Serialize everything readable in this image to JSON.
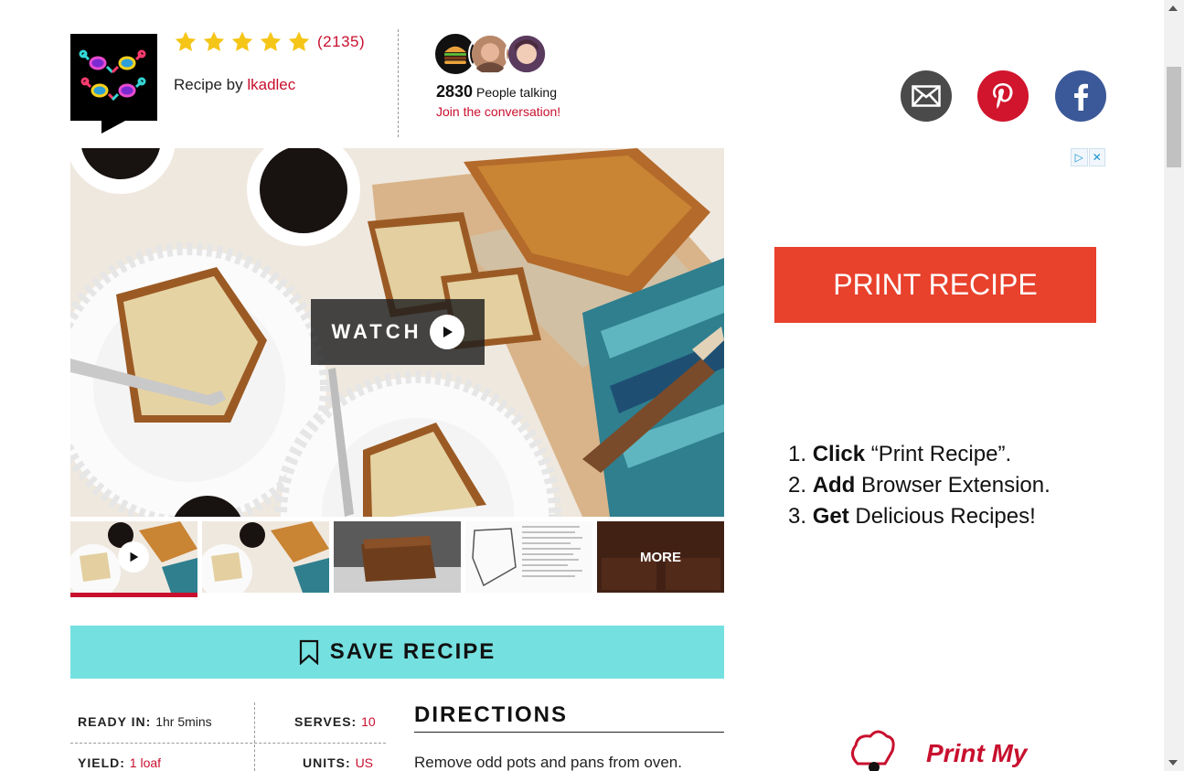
{
  "author": {
    "rating_count": "(2135)",
    "rating_stars": 5,
    "recipe_by_label": "Recipe by",
    "name": "lkadlec"
  },
  "conversation": {
    "count": "2830",
    "label": "People talking",
    "join": "Join the conversation!"
  },
  "social": {
    "email_icon": "envelope-icon",
    "pinterest_icon": "pinterest-icon",
    "facebook_icon": "facebook-icon"
  },
  "video": {
    "watch_label": "WATCH"
  },
  "thumbnails": {
    "more_label": "MORE"
  },
  "save": {
    "label": "SAVE RECIPE"
  },
  "info": {
    "ready_in_label": "READY IN:",
    "ready_in_value": "1hr 5mins",
    "serves_label": "SERVES:",
    "serves_value": "10",
    "yield_label": "YIELD:",
    "yield_value": "1 loaf",
    "units_label": "UNITS:",
    "units_value": "US"
  },
  "directions": {
    "heading": "DIRECTIONS",
    "first_step": "Remove odd pots and pans from oven."
  },
  "ad": {
    "print_button": "PRINT RECIPE",
    "step1_bold": "Click",
    "step1_rest": "“Print Recipe”.",
    "step2_bold": "Add",
    "step2_rest": "Browser Extension.",
    "step3_bold": "Get",
    "step3_rest": "Delicious Recipes!",
    "brand": "Print My"
  },
  "colors": {
    "accent_red": "#c8102e",
    "save_cyan": "#75e0e0",
    "print_orange": "#e8412c",
    "star_yellow": "#f5c518"
  }
}
